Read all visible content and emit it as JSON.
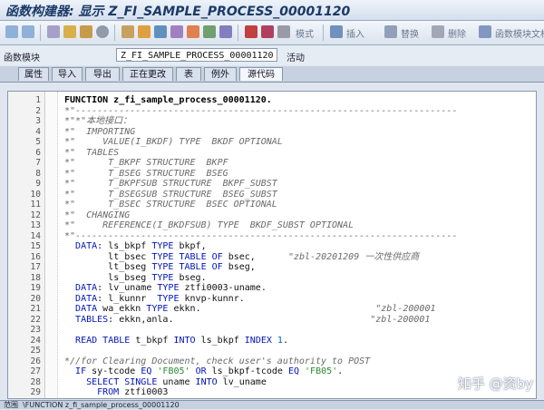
{
  "window": {
    "title": "函数构建器: 显示 Z_FI_SAMPLE_PROCESS_00001120"
  },
  "toolbar": {
    "pattern_label": "模式",
    "insert_label": "插入",
    "replace_label": "替换",
    "delete_label": "删除",
    "docs_label": "函数模块文档"
  },
  "function_module": {
    "label": "函数模块",
    "name": "Z_FI_SAMPLE_PROCESS_00001120",
    "status": "活动"
  },
  "tabs": [
    {
      "label": "属性"
    },
    {
      "label": "导入"
    },
    {
      "label": "导出"
    },
    {
      "label": "正在更改"
    },
    {
      "label": "表"
    },
    {
      "label": "例外"
    },
    {
      "label": "源代码"
    }
  ],
  "editor": {
    "lines": [
      {
        "n": "1",
        "text": "FUNCTION z_fi_sample_process_00001120."
      },
      {
        "n": "2",
        "text": "*\"----------------------------------------------------------------------"
      },
      {
        "n": "3",
        "text": "*\"*\"本地接口："
      },
      {
        "n": "4",
        "text": "*\"  IMPORTING"
      },
      {
        "n": "5",
        "text": "*\"     VALUE(I_BKDF) TYPE  BKDF OPTIONAL"
      },
      {
        "n": "6",
        "text": "*\"  TABLES"
      },
      {
        "n": "7",
        "text": "*\"      T_BKPF STRUCTURE  BKPF"
      },
      {
        "n": "8",
        "text": "*\"      T_BSEG STRUCTURE  BSEG"
      },
      {
        "n": "9",
        "text": "*\"      T_BKPFSUB STRUCTURE  BKPF_SUBST"
      },
      {
        "n": "10",
        "text": "*\"      T_BSEGSUB STRUCTURE  BSEG_SUBST"
      },
      {
        "n": "11",
        "text": "*\"      T_BSEC STRUCTURE  BSEC OPTIONAL"
      },
      {
        "n": "12",
        "text": "*\"  CHANGING"
      },
      {
        "n": "13",
        "text": "*\"     REFERENCE(I_BKDFSUB) TYPE  BKDF_SUBST OPTIONAL"
      },
      {
        "n": "14",
        "text": "*\"----------------------------------------------------------------------"
      },
      {
        "n": "15",
        "text": "  DATA: ls_bkpf TYPE bkpf,"
      },
      {
        "n": "16",
        "text": "        lt_bsec TYPE TABLE OF bsec,      \"zbl-20201209 一次性供应商"
      },
      {
        "n": "17",
        "text": "        lt_bseg TYPE TABLE OF bseg,"
      },
      {
        "n": "18",
        "text": "        ls_bseg TYPE bseg."
      },
      {
        "n": "19",
        "text": "  DATA: lv_uname TYPE ztfi0003-uname."
      },
      {
        "n": "20",
        "text": "  DATA: l_kunnr  TYPE knvp-kunnr."
      },
      {
        "n": "21",
        "text": "  DATA wa_ekkn TYPE ekkn.                                \"zbl-200001"
      },
      {
        "n": "22",
        "text": "  TABLES: ekkn,anla.                                    \"zbl-200001"
      },
      {
        "n": "23",
        "text": ""
      },
      {
        "n": "24",
        "text": "  READ TABLE t_bkpf INTO ls_bkpf INDEX 1."
      },
      {
        "n": "25",
        "text": ""
      },
      {
        "n": "26",
        "text": "*//for Clearing Document, check user's authority to POST"
      },
      {
        "n": "27",
        "text": "  IF sy-tcode EQ 'FB05' OR ls_bkpf-tcode EQ 'FB05'."
      },
      {
        "n": "28",
        "text": "    SELECT SINGLE uname INTO lv_uname"
      },
      {
        "n": "29",
        "text": "      FROM ztfi0003"
      }
    ]
  },
  "status_bar": {
    "text": "范围  \\FUNCTION z_fi_sample_process_00001120"
  },
  "watermark": "知乎 @资by",
  "colors": {
    "keyword": "#0015b8",
    "comment": "#6a6a6a",
    "string": "#2a8a2a",
    "number": "#0060c0"
  }
}
